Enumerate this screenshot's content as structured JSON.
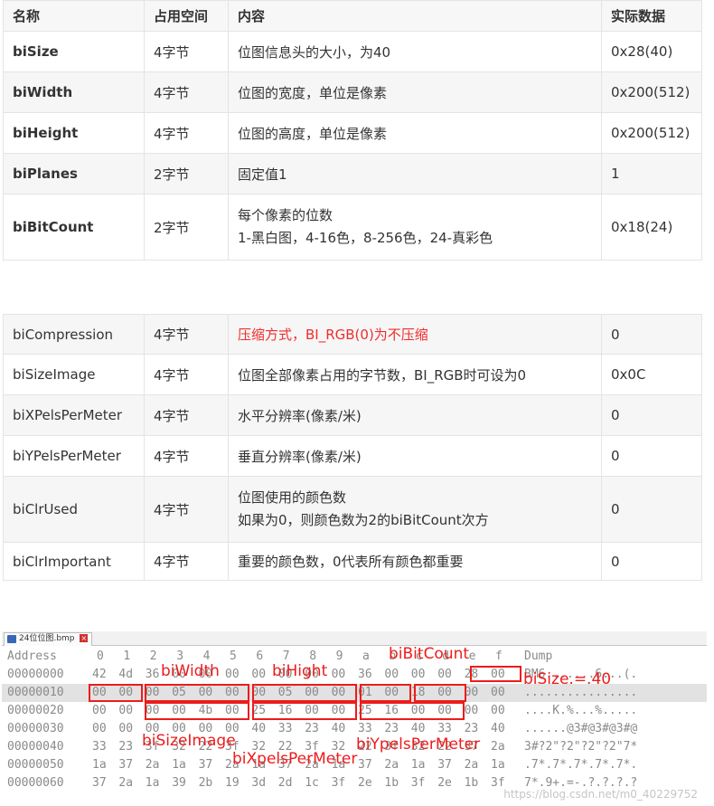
{
  "table1": {
    "headers": [
      "名称",
      "占用空间",
      "内容",
      "实际数据"
    ],
    "rows": [
      {
        "name": "biSize",
        "size": "4字节",
        "content": "位图信息头的大小，为40",
        "value": "0x28(40)"
      },
      {
        "name": "biWidth",
        "size": "4字节",
        "content": "位图的宽度，单位是像素",
        "value": "0x200(512)"
      },
      {
        "name": "biHeight",
        "size": "4字节",
        "content": "位图的高度，单位是像素",
        "value": "0x200(512)"
      },
      {
        "name": "biPlanes",
        "size": "2字节",
        "content": "固定值1",
        "value": "1"
      },
      {
        "name": "biBitCount",
        "size": "2字节",
        "content_line1": "每个像素的位数",
        "content_line2": "1-黑白图，4-16色，8-256色，24-真彩色",
        "value": "0x18(24)"
      }
    ]
  },
  "table2": {
    "rows": [
      {
        "name": "biCompression",
        "size": "4字节",
        "content": "压缩方式，BI_RGB(0)为不压缩",
        "value": "0"
      },
      {
        "name": "biSizeImage",
        "size": "4字节",
        "content": "位图全部像素占用的字节数，BI_RGB时可设为0",
        "value": "0x0C"
      },
      {
        "name": "biXPelsPerMeter",
        "size": "4字节",
        "content": "水平分辨率(像素/米)",
        "value": "0"
      },
      {
        "name": "biYPelsPerMeter",
        "size": "4字节",
        "content": "垂直分辨率(像素/米)",
        "value": "0"
      },
      {
        "name": "biClrUsed",
        "size": "4字节",
        "content_line1": "位图使用的颜色数",
        "content_line2": "如果为0，则颜色数为2的biBitCount次方",
        "value": "0"
      },
      {
        "name": "biClrImportant",
        "size": "4字节",
        "content": "重要的颜色数，0代表所有颜色都重要",
        "value": "0"
      }
    ]
  },
  "hex_editor": {
    "tab_label": "24位位图.bmp",
    "header": {
      "address": "Address",
      "cols": [
        "0",
        "1",
        "2",
        "3",
        "4",
        "5",
        "6",
        "7",
        "8",
        "9",
        "a",
        "b",
        "c",
        "d",
        "e",
        "f"
      ],
      "dump": "Dump"
    },
    "rows": [
      {
        "addr": "00000000",
        "bytes": [
          "42",
          "4d",
          "36",
          "00",
          "00",
          "00",
          "00",
          "00",
          "00",
          "00",
          "36",
          "00",
          "00",
          "00",
          "28",
          "00"
        ],
        "dump": "BM6.......6...(."
      },
      {
        "addr": "00000010",
        "bytes": [
          "00",
          "00",
          "00",
          "05",
          "00",
          "00",
          "00",
          "05",
          "00",
          "00",
          "01",
          "00",
          "18",
          "00",
          "00",
          "00"
        ],
        "dump": "................"
      },
      {
        "addr": "00000020",
        "bytes": [
          "00",
          "00",
          "00",
          "00",
          "4b",
          "00",
          "25",
          "16",
          "00",
          "00",
          "25",
          "16",
          "00",
          "00",
          "00",
          "00"
        ],
        "dump": "....K.%...%....."
      },
      {
        "addr": "00000030",
        "bytes": [
          "00",
          "00",
          "00",
          "00",
          "00",
          "00",
          "40",
          "33",
          "23",
          "40",
          "33",
          "23",
          "40",
          "33",
          "23",
          "40"
        ],
        "dump": "......@3#@3#@3#@"
      },
      {
        "addr": "00000040",
        "bytes": [
          "33",
          "23",
          "3f",
          "32",
          "22",
          "3f",
          "32",
          "22",
          "3f",
          "32",
          "22",
          "3f",
          "32",
          "22",
          "37",
          "2a"
        ],
        "dump": "3#?2\"?2\"?2\"?2\"7*"
      },
      {
        "addr": "00000050",
        "bytes": [
          "1a",
          "37",
          "2a",
          "1a",
          "37",
          "2a",
          "1a",
          "37",
          "2a",
          "1a",
          "37",
          "2a",
          "1a",
          "37",
          "2a",
          "1a"
        ],
        "dump": ".7*.7*.7*.7*.7*."
      },
      {
        "addr": "00000060",
        "bytes": [
          "37",
          "2a",
          "1a",
          "39",
          "2b",
          "19",
          "3d",
          "2d",
          "1c",
          "3f",
          "2e",
          "1b",
          "3f",
          "2e",
          "1b",
          "3f"
        ],
        "dump": "7*.9+.=-.?.?.?.?"
      }
    ],
    "annotations": {
      "biWidth": "biWidth",
      "biHight": "biHight",
      "biBitCount": "biBitCount",
      "biSize": "biSize.=.40",
      "biSizeImage": "biSizeImage",
      "biXpelsPerMeter": "biXpelsPerMeter",
      "biYpelsPerMeter": "biYpelsPerMeter"
    },
    "watermark": "https://blog.csdn.net/m0_40229752",
    "colors": {
      "annotation": "#ee1b1b",
      "highlight_row": "#e2e2e2"
    }
  },
  "colors": {
    "red_text": "#f02d2d",
    "header_bg": "#f7f7f7",
    "row_alt_bg": "#f6f6f6"
  }
}
